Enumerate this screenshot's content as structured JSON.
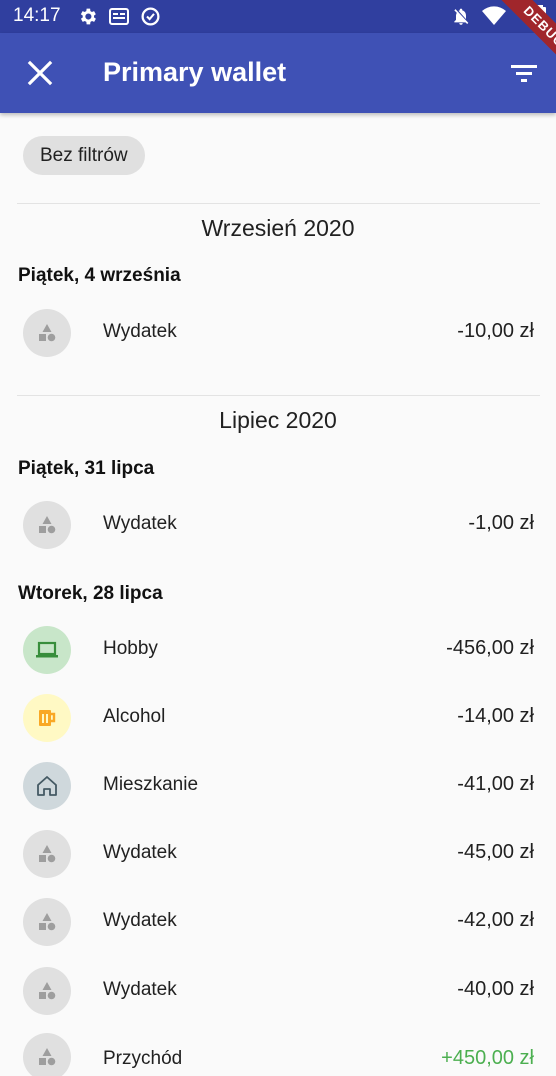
{
  "status_bar": {
    "time": "14:17"
  },
  "app_bar": {
    "title": "Primary wallet"
  },
  "debug_banner": "DEBUG",
  "filter_chip": "Bez filtrów",
  "months": [
    "Wrzesień 2020",
    "Lipiec 2020"
  ],
  "days": [
    "Piątek, 4 września",
    "Piątek, 31 lipca",
    "Wtorek, 28 lipca"
  ],
  "transactions": [
    {
      "label": "Wydatek",
      "amount": "-10,00 zł",
      "icon": "category-shapes-icon",
      "color": "#e0e0e0"
    },
    {
      "label": "Wydatek",
      "amount": "-1,00 zł",
      "icon": "category-shapes-icon",
      "color": "#e0e0e0"
    },
    {
      "label": "Hobby",
      "amount": "-456,00 zł",
      "icon": "laptop-icon",
      "color": "#c8e6c9"
    },
    {
      "label": "Alcohol",
      "amount": "-14,00 zł",
      "icon": "beer-mug-icon",
      "color": "#fff9c4"
    },
    {
      "label": "Mieszkanie",
      "amount": "-41,00 zł",
      "icon": "home-icon",
      "color": "#cfd8dc"
    },
    {
      "label": "Wydatek",
      "amount": "-45,00 zł",
      "icon": "category-shapes-icon",
      "color": "#e0e0e0"
    },
    {
      "label": "Wydatek",
      "amount": "-42,00 zł",
      "icon": "category-shapes-icon",
      "color": "#e0e0e0"
    },
    {
      "label": "Wydatek",
      "amount": "-40,00 zł",
      "icon": "category-shapes-icon",
      "color": "#e0e0e0"
    },
    {
      "label": "Przychód",
      "amount": "+450,00 zł",
      "icon": "category-shapes-icon",
      "color": "#e0e0e0",
      "income_color": "#4caf50"
    }
  ]
}
